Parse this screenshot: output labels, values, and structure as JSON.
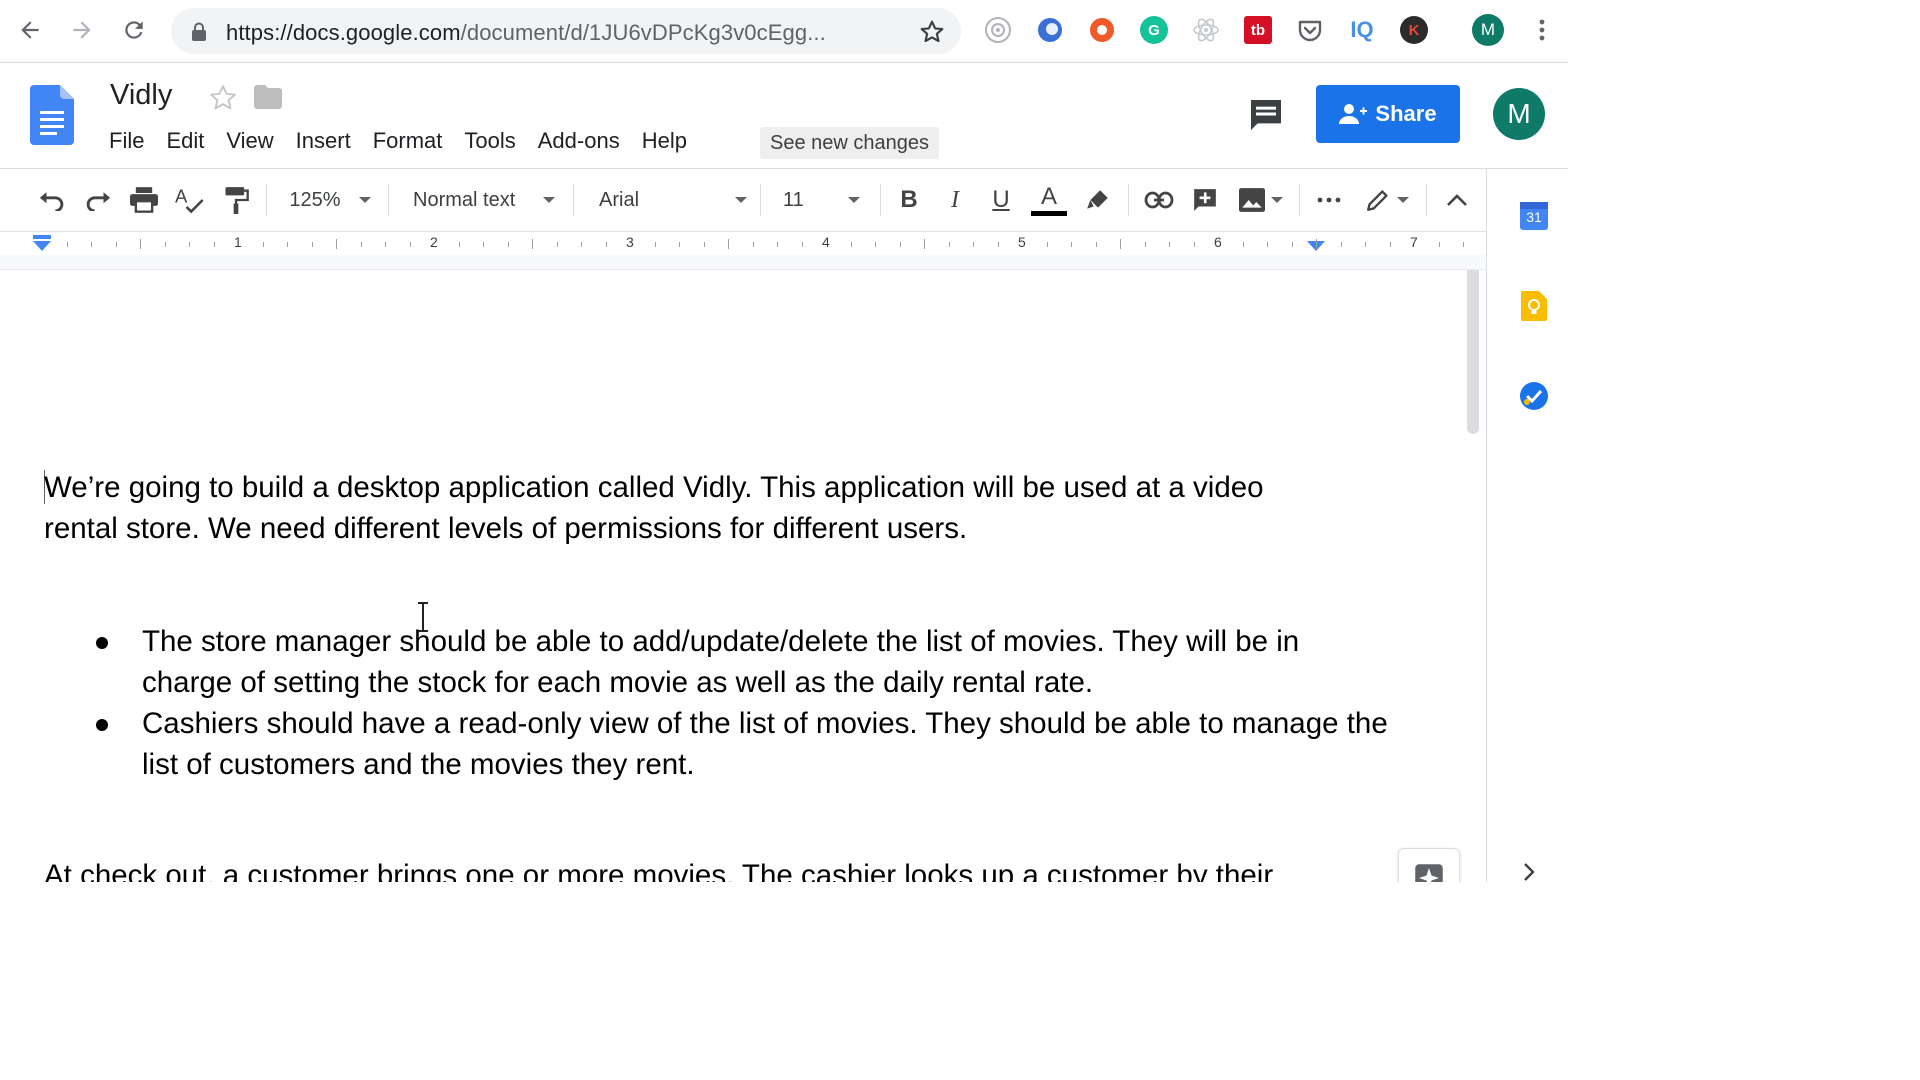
{
  "browser": {
    "url_host": "https://docs.google.com",
    "url_path": "/document/d/1JU6vDPcKg3v0cEgg...",
    "profile_initial": "M",
    "extensions": [
      {
        "icon": "camera-extension-icon"
      },
      {
        "icon": "blue-orb-extension-icon"
      },
      {
        "icon": "orange-extension-icon"
      },
      {
        "icon": "grammarly-extension-icon",
        "label": "G"
      },
      {
        "icon": "react-extension-icon"
      },
      {
        "icon": "tb-extension-icon",
        "label": "tb"
      },
      {
        "icon": "pocket-extension-icon"
      },
      {
        "icon": "iq-extension-icon",
        "label": "IQ"
      },
      {
        "icon": "k-extension-icon",
        "label": "K"
      }
    ]
  },
  "docs": {
    "title": "Vidly",
    "menu": [
      "File",
      "Edit",
      "View",
      "Insert",
      "Format",
      "Tools",
      "Add-ons",
      "Help"
    ],
    "see_new_changes": "See new changes",
    "share_label": "Share",
    "account_initial": "M"
  },
  "toolbar": {
    "zoom": "125%",
    "style": "Normal text",
    "font": "Arial",
    "size": "11",
    "bold": "B",
    "italic": "I",
    "underline": "U",
    "text_color_glyph": "A"
  },
  "ruler": {
    "numbers": [
      "1",
      "2",
      "3",
      "4",
      "5",
      "6",
      "7"
    ]
  },
  "side_panel": {
    "calendar_day": "31"
  },
  "document": {
    "intro": "We’re going to build a desktop application called Vidly. This application will be used at a video rental store. We need different levels of permissions for different users.",
    "bullets": [
      "The store manager should be able to add/update/delete the list of movies. They will be in charge of setting the stock for each movie as well as the daily rental rate.",
      "Cashiers should have a read-only view of the list of movies. They should be able to manage the list of customers and the movies they rent."
    ],
    "checkout": "At check out, a customer brings one or more movies. The cashier looks up a customer by their"
  },
  "colors": {
    "accent": "#1a73e8",
    "avatar": "#0f7a68",
    "docs_blue": "#4285f4"
  }
}
